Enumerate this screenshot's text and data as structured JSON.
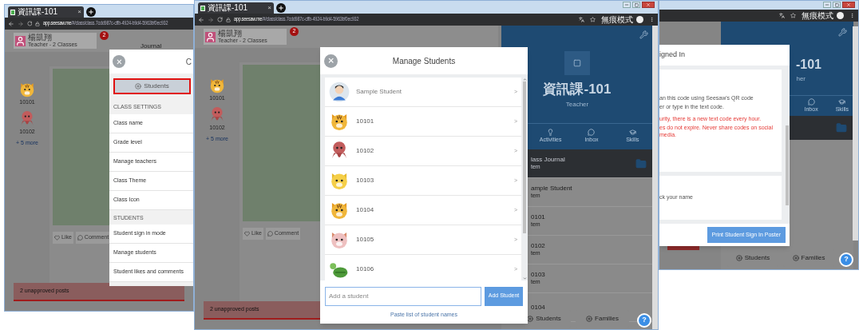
{
  "left_window": {
    "tab_title": "資訊課-101",
    "tab_close": "×",
    "url_host": "app.seesaw.me",
    "url_path": "/#/class/class.7cdd987c-cffb-4924-b9d4-5963bf0ec932",
    "teacher": {
      "name": "楊凱翔",
      "subtitle": "Teacher - 2 Classes",
      "badge": "2"
    },
    "journal_title": "Journal",
    "students": [
      {
        "name": "10101",
        "kind": "tiger"
      },
      {
        "name": "10102",
        "kind": "octopus"
      }
    ],
    "more_link": "+ 5 more",
    "post_actions": [
      {
        "label": "Like",
        "kind": "like"
      },
      {
        "label": "Comment",
        "kind": "comment"
      }
    ],
    "alert": "2 unapproved posts",
    "settings": {
      "title": "C",
      "students_button": "Students",
      "sections": [
        {
          "heading": "CLASS SETTINGS",
          "items": [
            "Class name",
            "Grade level",
            "Manage teachers",
            "Class Theme",
            "Class Icon"
          ]
        },
        {
          "heading": "STUDENTS",
          "items": [
            "Student sign in mode",
            "Manage students",
            "Student likes and comments"
          ]
        }
      ]
    }
  },
  "middle_window": {
    "tab_title": "資訊課-101",
    "tab_close": "×",
    "url_host": "app.seesaw.me",
    "url_path": "/#/class/class.7cdd987c-cffb-4924-b9d4-5963bf0ec932",
    "incognito": "無痕模式",
    "teacher": {
      "name": "楊凱翔",
      "subtitle": "Teacher - 2 Classes",
      "badge": "2"
    },
    "students": [
      {
        "name": "10101",
        "kind": "tiger"
      },
      {
        "name": "10102",
        "kind": "octopus"
      }
    ],
    "more_link": "+ 5 more",
    "post_actions": [
      {
        "label": "Like",
        "kind": "like"
      },
      {
        "label": "Comment",
        "kind": "comment"
      }
    ],
    "alert": "2 unapproved posts",
    "modal": {
      "title": "Manage Students",
      "rows": [
        {
          "name": "Sample Student",
          "kind": "person"
        },
        {
          "name": "10101",
          "kind": "tiger"
        },
        {
          "name": "10102",
          "kind": "octopus"
        },
        {
          "name": "10103",
          "kind": "cat"
        },
        {
          "name": "10104",
          "kind": "tiger"
        },
        {
          "name": "10105",
          "kind": "hamster"
        },
        {
          "name": "10106",
          "kind": "turtle"
        }
      ],
      "row_arrow": ">",
      "input_placeholder": "Add a student",
      "add_button": "Add Student",
      "paste_link": "Paste list of student names"
    },
    "class_panel": {
      "title": "資訊課-101",
      "role": "Teacher",
      "nav": [
        {
          "label": "Activities",
          "kind": "activities"
        },
        {
          "label": "Inbox",
          "kind": "inbox"
        },
        {
          "label": "Skills",
          "kind": "skills"
        }
      ],
      "feed": [
        {
          "title": "lass Journal",
          "sub": "tem",
          "kind": "journal"
        },
        {
          "title": "ample Student",
          "sub": "tem",
          "kind": "student"
        },
        {
          "title": "0101",
          "sub": "tem",
          "kind": "student"
        },
        {
          "title": "0102",
          "sub": "tem",
          "kind": "student"
        },
        {
          "title": "0103",
          "sub": "tem",
          "kind": "student"
        },
        {
          "title": "0104",
          "kind": "student"
        }
      ],
      "bottom_buttons": [
        "Students",
        "Families"
      ],
      "help": "?"
    }
  },
  "right_window": {
    "incognito": "無痕模式",
    "modal": {
      "title": "igned In",
      "instructions": [
        "an this code using Seesaw's QR code",
        "er or type in the text code."
      ],
      "warnings": [
        "urity, there is a new text code every hour.",
        "es do not expire. Never share codes on social media."
      ],
      "pick_name": "ck your name",
      "print_button": "Print Student Sign In Poster"
    },
    "class_panel": {
      "title": "-101",
      "role": "her",
      "nav": [
        {
          "label": "Inbox",
          "kind": "inbox"
        },
        {
          "label": "Skills",
          "kind": "skills"
        }
      ],
      "bottom_buttons": [
        "Students",
        "Families"
      ],
      "help": "?"
    }
  }
}
